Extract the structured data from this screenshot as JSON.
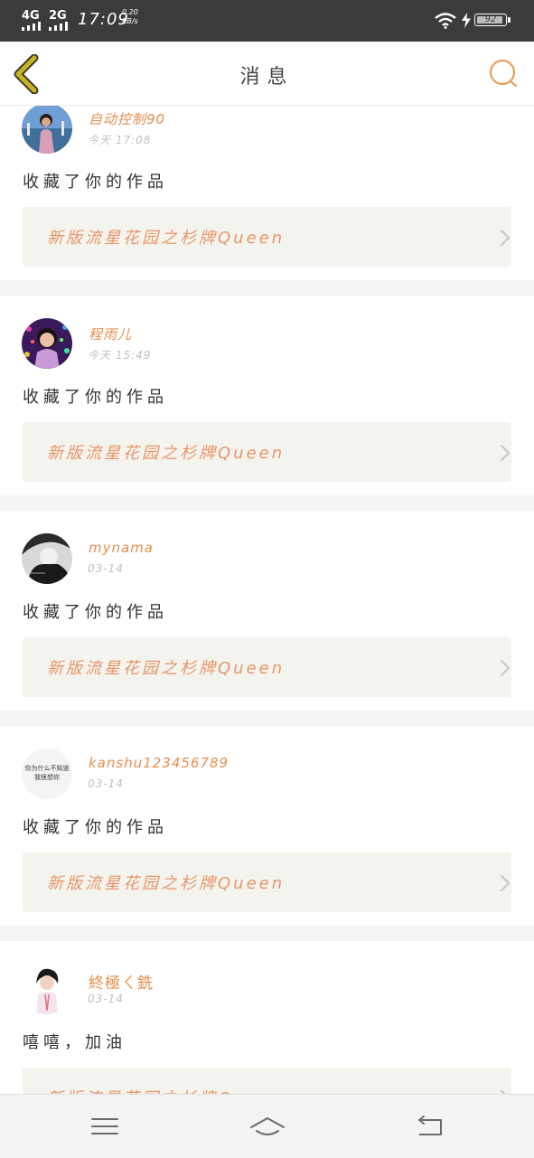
{
  "status_bar": {
    "network_1": "4G",
    "network_2": "2G",
    "time": "17:09",
    "speed_value": "0.20",
    "speed_unit": "KB/s",
    "battery": "92"
  },
  "header": {
    "title": "消息",
    "back_icon": "chevron-left-icon",
    "search_icon": "search-icon"
  },
  "messages": [
    {
      "user": "自动控制90",
      "time": "今天 17:08",
      "text": "收藏了你的作品",
      "work_title": "新版流星花园之杉牌Queen"
    },
    {
      "user": "程雨儿",
      "time": "今天 15:49",
      "text": "收藏了你的作品",
      "work_title": "新版流星花园之杉牌Queen"
    },
    {
      "user": "mynama",
      "time": "03-14",
      "text": "收藏了你的作品",
      "work_title": "新版流星花园之杉牌Queen"
    },
    {
      "user": "kanshu123456789",
      "time": "03-14",
      "text": "收藏了你的作品",
      "work_title": "新版流星花园之杉牌Queen"
    },
    {
      "user": "終極ㄑ銑",
      "time": "03-14",
      "text": "嘻嘻，加油",
      "work_title": "新版流星花园之杉牌Queen"
    }
  ],
  "avatar_texts": {
    "user4": [
      "你为什么不知道",
      "我很想你"
    ]
  },
  "nav_bar": {
    "menu_icon": "menu-icon",
    "home_icon": "home-icon",
    "back_icon": "back-icon"
  },
  "colors": {
    "accent": "#e58f4f",
    "status_bar": "#3b3b3b",
    "back_arrow": "#c9b325",
    "work_bg": "#f4f4ee"
  }
}
